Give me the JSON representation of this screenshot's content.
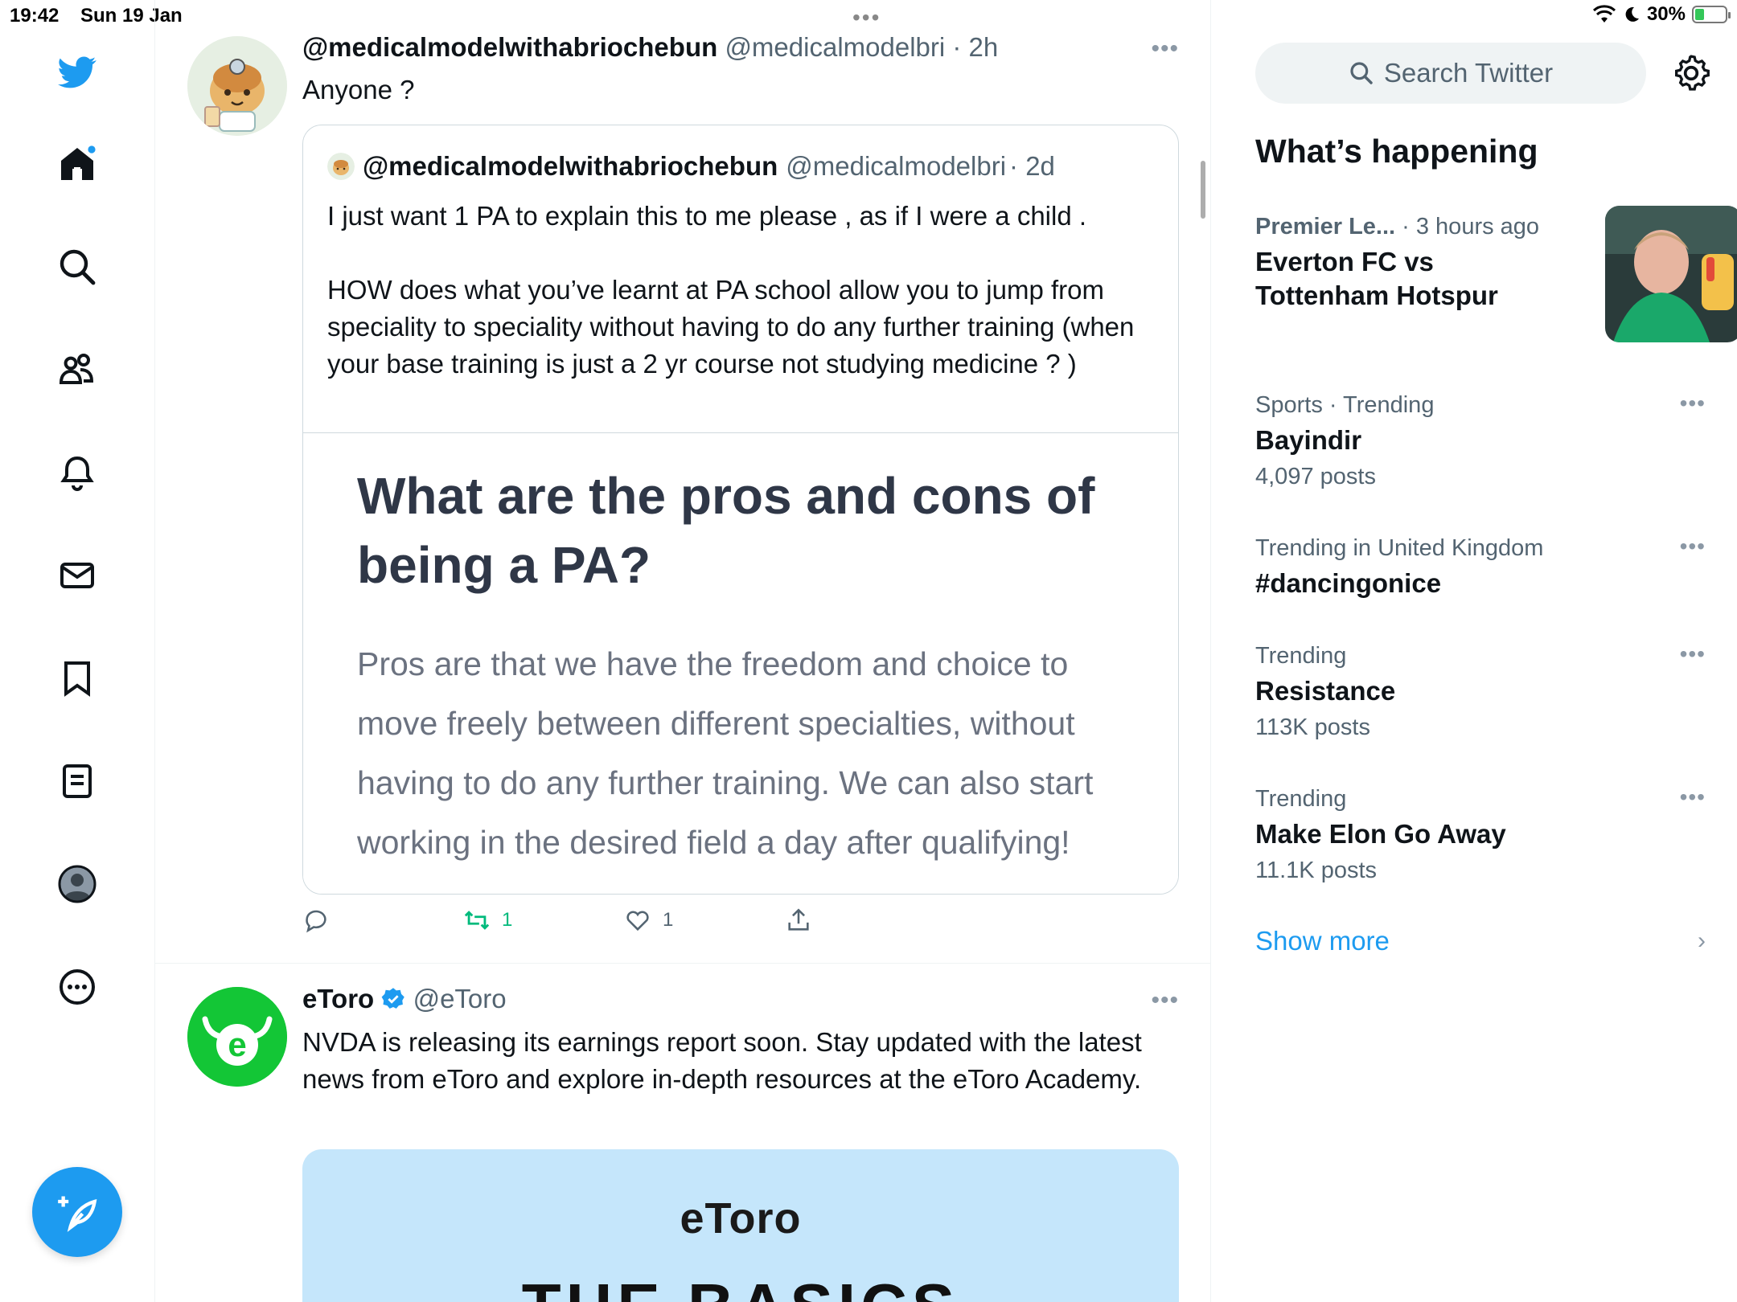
{
  "status_bar": {
    "time": "19:42",
    "date": "Sun 19 Jan",
    "battery": "30%",
    "battery_level": 0.3
  },
  "sidebar": {
    "icons": [
      "twitter-logo-icon",
      "home-icon",
      "search-icon",
      "communities-icon",
      "notifications-icon",
      "messages-icon",
      "bookmarks-icon",
      "lists-icon",
      "profile-icon",
      "more-icon"
    ],
    "compose_icon": "compose-tweet-icon"
  },
  "tweet1": {
    "name": "@medicalmodelwithabriochebun",
    "handle": "@medicalmodelbri",
    "time": "· 2h",
    "text": "Anyone ?",
    "quote": {
      "name": "@medicalmodelwithabriochebun",
      "handle": "@medicalmodelbri",
      "time": "· 2d",
      "text_line1": "I just want 1 PA to explain this to me please , as if I were a child .",
      "text_para2": "HOW does what you’ve learnt at PA school allow you to jump from speciality to speciality without having to do any further training (when your base training is just a 2 yr course not  studying medicine ? )",
      "media_title": "What are the pros and cons of being a PA?",
      "media_body": "Pros are that we have the freedom and choice to move freely between different specialties, without having to do any further training. We can also start working in the desired field a day after qualifying!"
    },
    "actions": {
      "reply": "",
      "retweets": "1",
      "likes": "1"
    },
    "colors": {
      "retweet": "#00ba7c"
    }
  },
  "tweet2": {
    "name": "eToro",
    "handle": "@eToro",
    "text": "NVDA is releasing its earnings report soon. Stay updated with the latest news from eToro and explore in-depth resources at the eToro Academy.",
    "media_logo": "eToro",
    "media_headline": "THE BASICS",
    "colors": {
      "brand": "#13c636"
    }
  },
  "right": {
    "search_placeholder": "Search Twitter",
    "whats_happening": "What’s happening",
    "trends": [
      {
        "category": "Premier Le...",
        "meta_suffix": "· 3 hours ago",
        "topic": "Everton FC vs Tottenham Hotspur",
        "count": ""
      },
      {
        "category": "Sports · Trending",
        "meta_suffix": "",
        "topic": "Bayindir",
        "count": "4,097 posts"
      },
      {
        "category": "Trending in United Kingdom",
        "meta_suffix": "",
        "topic": "#dancingonice",
        "count": ""
      },
      {
        "category": "Trending",
        "meta_suffix": "",
        "topic": "Resistance",
        "count": "113K posts"
      },
      {
        "category": "Trending",
        "meta_suffix": "",
        "topic": "Make Elon Go Away",
        "count": "11.1K posts"
      }
    ],
    "show_more": "Show more"
  },
  "accent": "#1d9bf0"
}
